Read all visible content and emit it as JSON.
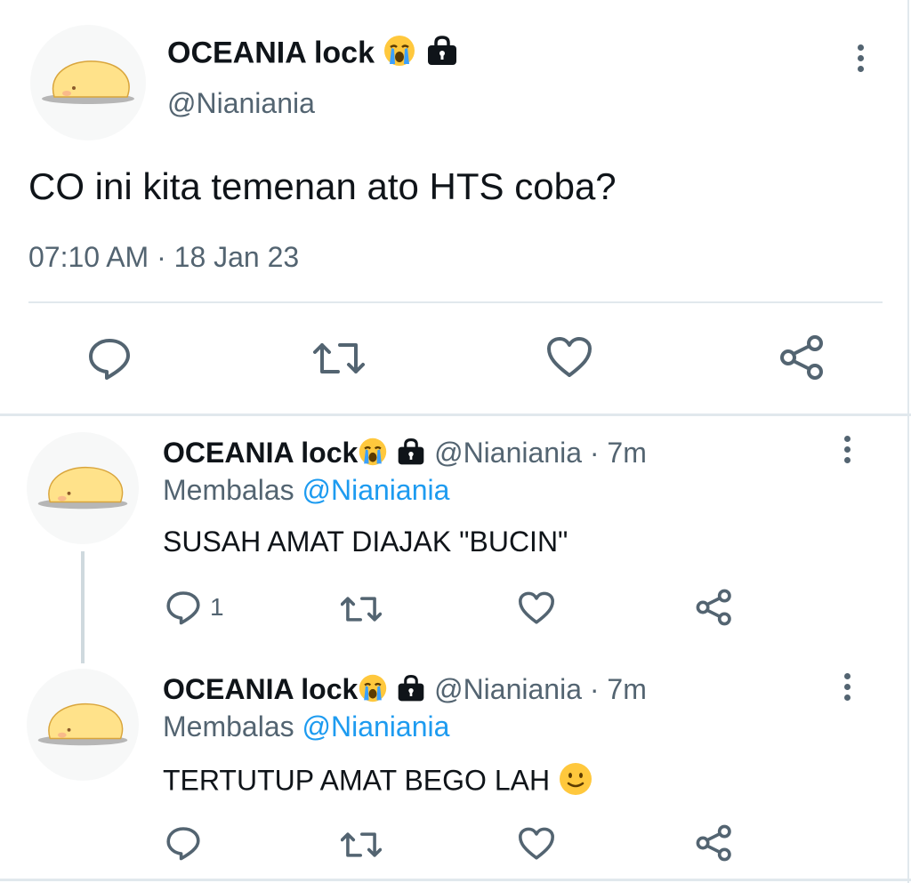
{
  "main_tweet": {
    "display_name": "OCEANIA lock",
    "handle": "@Nianiania",
    "text": "CO ini kita temenan ato HTS coba?",
    "timestamp": "07:10 AM · 18 Jan 23",
    "icons": [
      "crying-emoji",
      "lock-icon",
      "more-vert-icon",
      "reply-icon",
      "retweet-icon",
      "like-icon",
      "share-icon"
    ]
  },
  "replies": [
    {
      "display_name": "OCEANIA lock",
      "handle": "@Nianiania",
      "time": "· 7m",
      "replying_prefix": "Membalas",
      "replying_to": "@Nianiania",
      "text": "SUSAH AMAT DIAJAK \"BUCIN\"",
      "reply_count": "1"
    },
    {
      "display_name": "OCEANIA lock",
      "handle": "@Nianiania",
      "time": "· 7m",
      "replying_prefix": "Membalas",
      "replying_to": "@Nianiania",
      "text": "TERTUTUP AMAT BEGO LAH",
      "reply_count": ""
    }
  ],
  "colors": {
    "text": "#0f1419",
    "secondary": "#536471",
    "link": "#1d9bf0",
    "divider": "#e1e8ed"
  }
}
